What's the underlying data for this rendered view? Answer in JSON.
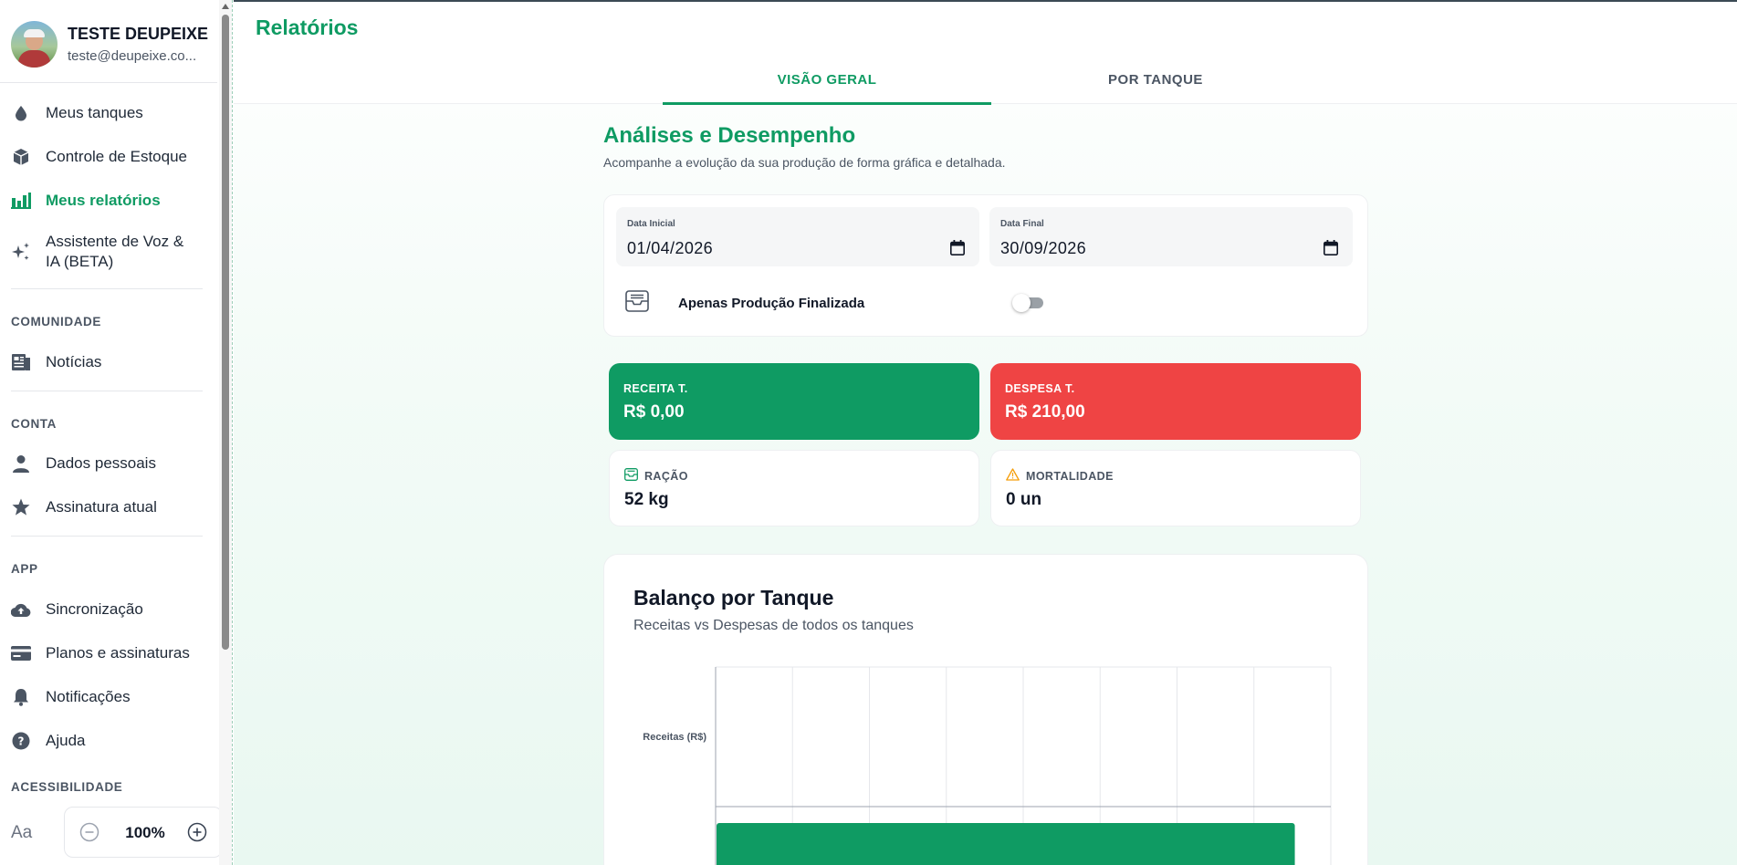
{
  "sidebar": {
    "profile": {
      "name": "TESTE DEUPEIXE",
      "email": "teste@deupeixe.co..."
    },
    "main_items": [
      {
        "label": "Meus tanques",
        "icon": "water-drop-icon"
      },
      {
        "label": "Controle de Estoque",
        "icon": "box-icon"
      },
      {
        "label": "Meus relatórios",
        "icon": "bar-chart-icon",
        "active": true
      },
      {
        "label": "Assistente de Voz & IA (BETA)",
        "icon": "sparkles-icon"
      }
    ],
    "sections": {
      "comunidade": "COMUNIDADE",
      "conta": "CONTA",
      "app": "APP",
      "acessibilidade": "ACESSIBILIDADE"
    },
    "comunidade_items": [
      {
        "label": "Notícias",
        "icon": "newspaper-icon"
      }
    ],
    "conta_items": [
      {
        "label": "Dados pessoais",
        "icon": "person-icon"
      },
      {
        "label": "Assinatura atual",
        "icon": "star-icon"
      }
    ],
    "app_items": [
      {
        "label": "Sincronização",
        "icon": "cloud-upload-icon"
      },
      {
        "label": "Planos e assinaturas",
        "icon": "credit-card-icon"
      },
      {
        "label": "Notificações",
        "icon": "bell-icon"
      },
      {
        "label": "Ajuda",
        "icon": "help-icon"
      }
    ],
    "accessibility": {
      "font_label": "Aa",
      "zoom": "100%"
    }
  },
  "header": {
    "title": "Relatórios",
    "tabs": [
      {
        "label": "VISÃO GERAL",
        "active": true
      },
      {
        "label": "POR TANQUE",
        "active": false
      }
    ]
  },
  "overview": {
    "title": "Análises e Desempenho",
    "subtitle": "Acompanhe a evolução da sua produção de forma gráfica e detalhada.",
    "filters": {
      "start_label": "Data Inicial",
      "start_value": "01/04/2026",
      "end_label": "Data Final",
      "end_value": "30/09/2026",
      "finished_only_label": "Apenas Produção Finalizada",
      "finished_only": false
    },
    "stats": {
      "receita": {
        "label": "RECEITA T.",
        "value": "R$ 0,00"
      },
      "despesa": {
        "label": "DESPESA T.",
        "value": "R$ 210,00"
      },
      "racao": {
        "label": "RAÇÃO",
        "value": "52 kg"
      },
      "mortalidade": {
        "label": "MORTALIDADE",
        "value": "0 un"
      }
    }
  },
  "colors": {
    "accent": "#0f9b63",
    "danger": "#ef4444",
    "warning": "#f59e0b"
  },
  "chart_data": {
    "type": "bar",
    "title": "Balanço por Tanque",
    "subtitle": "Receitas vs Despesas de todos os tanques",
    "ylabel": "Receitas (R$)",
    "orientation": "horizontal",
    "grid": true,
    "xlim": [
      0,
      8
    ],
    "categories": [
      ""
    ],
    "series": [
      {
        "name": "Receitas (R$)",
        "values": [
          0
        ]
      }
    ],
    "partial_visible_bar": {
      "color": "#0f9b63",
      "value_fraction_of_axis": 0.94
    }
  }
}
